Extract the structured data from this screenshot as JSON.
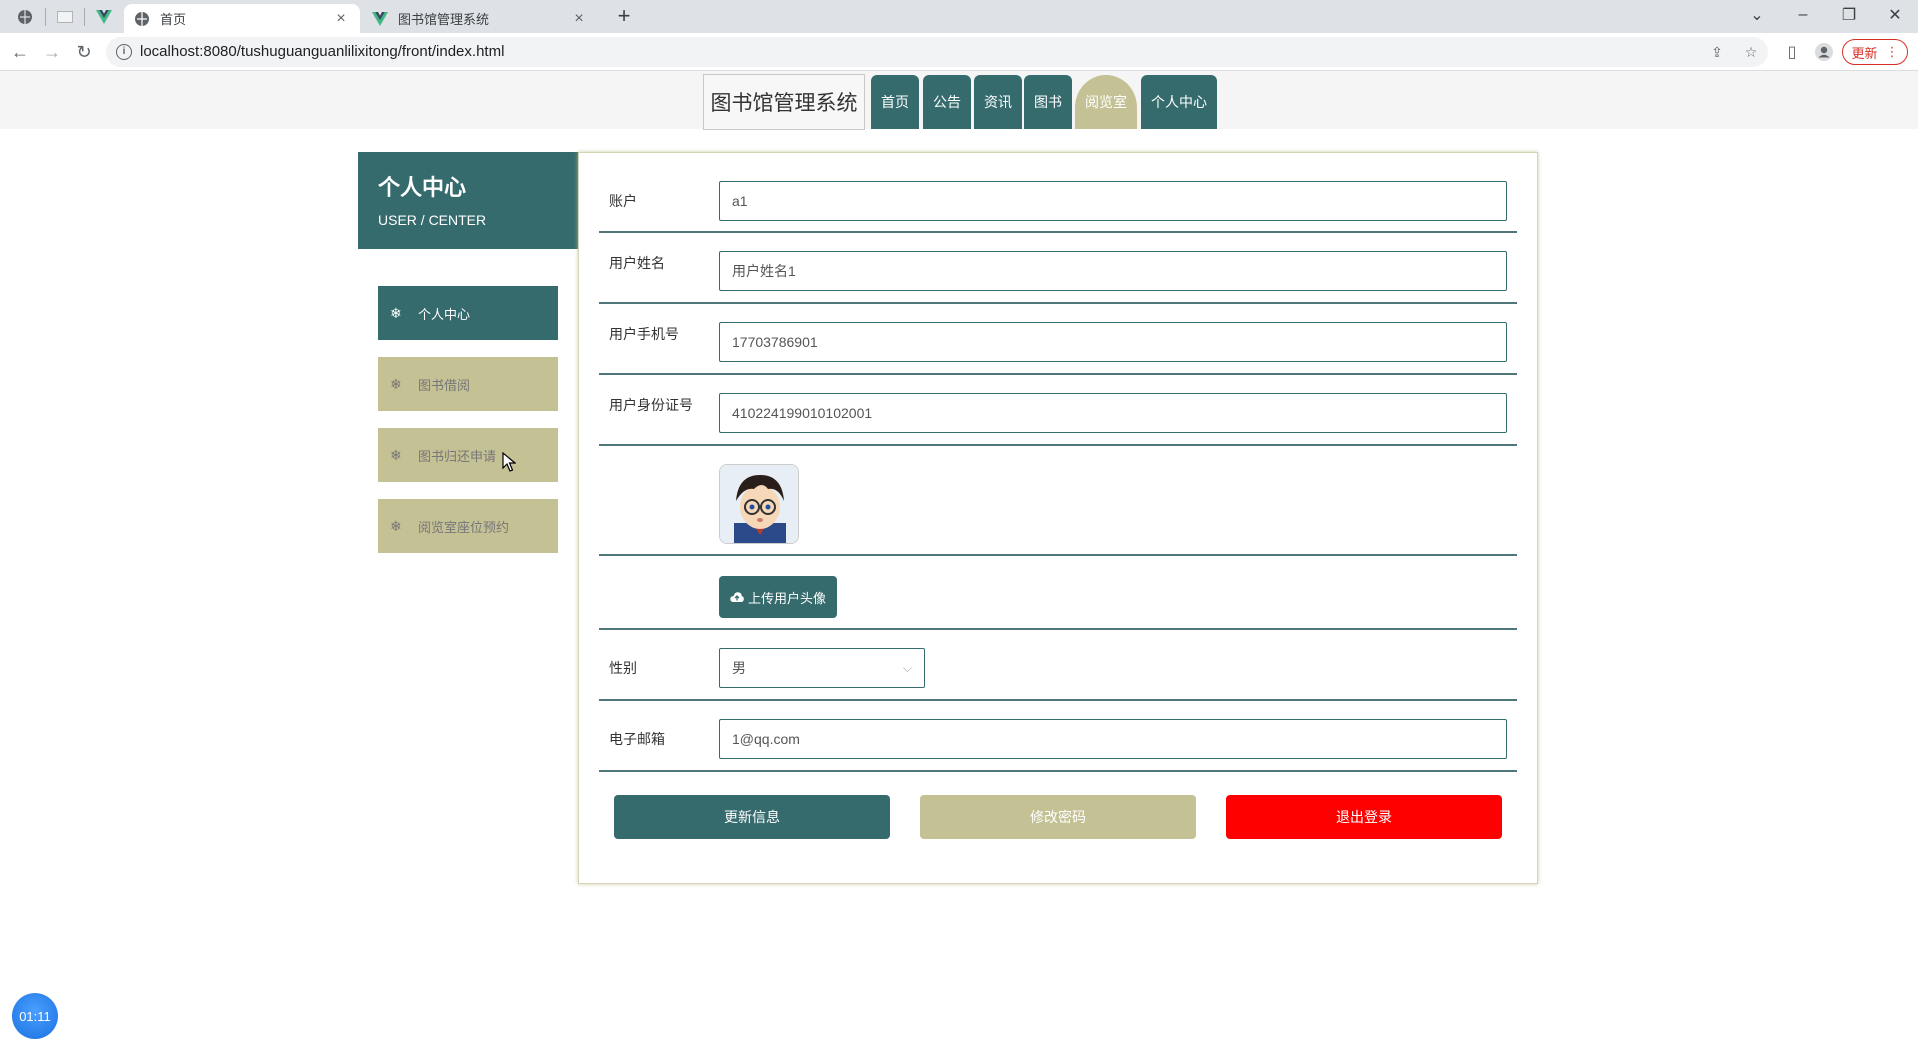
{
  "browser": {
    "tabs": [
      {
        "title": "首页",
        "active": true
      },
      {
        "title": "图书馆管理系统",
        "active": false
      }
    ],
    "url": "localhost:8080/tushuguanguanlilixitong/front/index.html",
    "update_label": "更新"
  },
  "header": {
    "brand": "图书馆管理系统",
    "nav": [
      "首页",
      "公告",
      "资讯",
      "图书",
      "阅览室",
      "个人中心"
    ],
    "active_nav": "阅览室"
  },
  "sidebar": {
    "title": "个人中心",
    "subtitle": "USER / CENTER",
    "items": [
      "个人中心",
      "图书借阅",
      "图书归还申请",
      "阅览室座位预约"
    ]
  },
  "form": {
    "account_label": "账户",
    "account_value": "a1",
    "name_label": "用户姓名",
    "name_value": "用户姓名1",
    "phone_label": "用户手机号",
    "phone_value": "17703786901",
    "id_label": "用户身份证号",
    "id_value": "410224199010102001",
    "upload_label": "上传用户头像",
    "gender_label": "性别",
    "gender_value": "男",
    "email_label": "电子邮箱",
    "email_value": "1@qq.com"
  },
  "actions": {
    "update": "更新信息",
    "change_password": "修改密码",
    "logout": "退出登录"
  },
  "timer": "01:11",
  "colors": {
    "primary": "#366b6e",
    "secondary": "#c4c195",
    "danger": "#ff0000"
  }
}
